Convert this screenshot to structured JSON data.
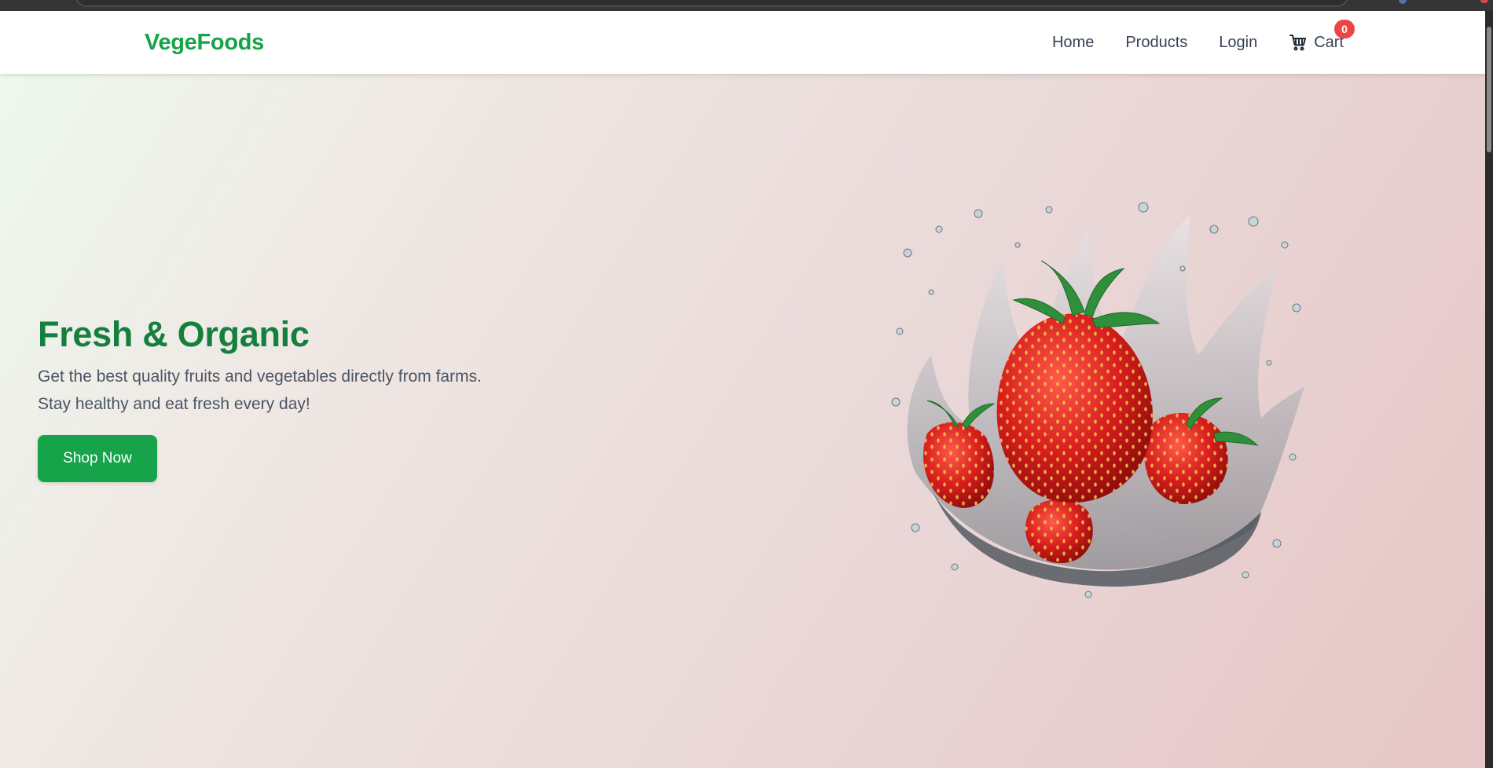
{
  "brand": {
    "name": "VegeFoods",
    "color": "#16a34a"
  },
  "nav": {
    "items": [
      {
        "label": "Home"
      },
      {
        "label": "Products"
      },
      {
        "label": "Login"
      }
    ],
    "cart": {
      "label": "Cart",
      "count": "0",
      "icon": "shopping-cart-icon"
    }
  },
  "hero": {
    "title": "Fresh & Organic",
    "subtitle_line1": "Get the best quality fruits and vegetables directly from farms.",
    "subtitle_line2": "Stay healthy and eat fresh every day!",
    "cta_label": "Shop Now",
    "image": "strawberries-water-splash"
  },
  "colors": {
    "accent": "#16a34a",
    "title": "#15803d",
    "badge": "#ef4444"
  }
}
